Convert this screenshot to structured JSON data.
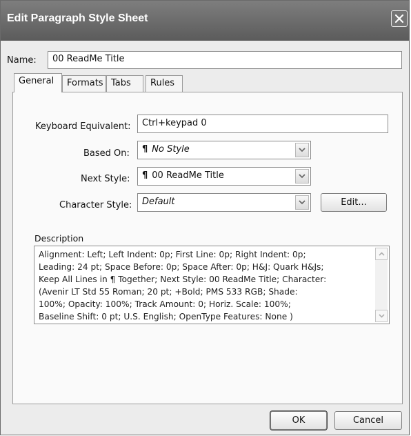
{
  "window": {
    "title": "Edit Paragraph Style Sheet"
  },
  "name_field": {
    "label": "Name:",
    "value": "00 ReadMe Title"
  },
  "tabs": [
    {
      "label": "General",
      "active": true
    },
    {
      "label": "Formats",
      "active": false
    },
    {
      "label": "Tabs",
      "active": false
    },
    {
      "label": "Rules",
      "active": false
    }
  ],
  "general": {
    "keyboard_equivalent": {
      "label": "Keyboard Equivalent:",
      "value": "Ctrl+keypad 0"
    },
    "based_on": {
      "label": "Based On:",
      "value": "No Style"
    },
    "next_style": {
      "label": "Next Style:",
      "value": "00 ReadMe Title"
    },
    "character_style": {
      "label": "Character Style:",
      "value": "Default",
      "edit_label": "Edit..."
    },
    "description": {
      "label": "Description",
      "lines": [
        "Alignment: Left;  Left Indent: 0p;  First Line: 0p;  Right Indent: 0p;",
        "Leading: 24 pt;  Space Before: 0p;  Space After: 0p;  H&J: Quark H&Js;",
        " Keep All Lines in ¶ Together;  Next Style: 00 ReadMe Title;  Character:",
        "(Avenir LT Std 55 Roman;  20 pt;  +Bold;  PMS 533 RGB;  Shade:",
        "100%;  Opacity: 100%;  Track Amount: 0;  Horiz. Scale: 100%;",
        "Baseline Shift: 0 pt;  U.S. English;  OpenType Features: None )"
      ]
    }
  },
  "buttons": {
    "ok": "OK",
    "cancel": "Cancel"
  },
  "icons": {
    "close": "close-icon",
    "dropdown": "chevron-down-icon",
    "pilcrow": "pilcrow-icon",
    "scroll_up": "scroll-up-icon",
    "scroll_down": "scroll-down-icon"
  },
  "glyphs": {
    "pilcrow": "¶"
  }
}
